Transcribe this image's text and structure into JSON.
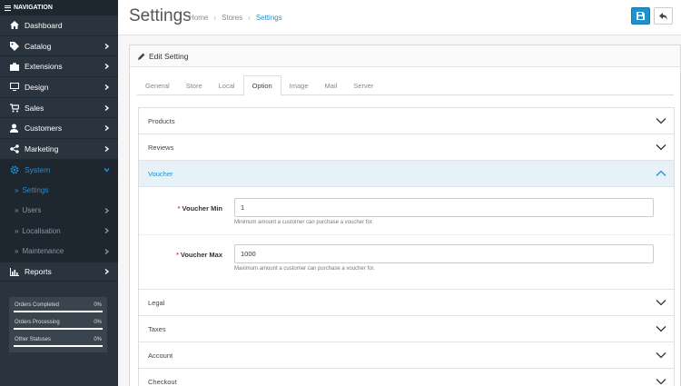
{
  "sidebar": {
    "header": "NAVIGATION",
    "items": [
      {
        "label": "Dashboard",
        "icon": "dashboard-icon",
        "chevron": false
      },
      {
        "label": "Catalog",
        "icon": "tag-icon",
        "chevron": true
      },
      {
        "label": "Extensions",
        "icon": "puzzle-icon",
        "chevron": true
      },
      {
        "label": "Design",
        "icon": "monitor-icon",
        "chevron": true
      },
      {
        "label": "Sales",
        "icon": "cart-icon",
        "chevron": true
      },
      {
        "label": "Customers",
        "icon": "user-icon",
        "chevron": true
      },
      {
        "label": "Marketing",
        "icon": "share-icon",
        "chevron": true
      },
      {
        "label": "System",
        "icon": "gear-icon",
        "chevron": true,
        "active": true
      }
    ],
    "system_submenu": [
      {
        "label": "Settings",
        "active": true,
        "chevron": false
      },
      {
        "label": "Users",
        "chevron": true
      },
      {
        "label": "Localisation",
        "chevron": true
      },
      {
        "label": "Maintenance",
        "chevron": true
      }
    ],
    "reports": {
      "label": "Reports",
      "icon": "bar-chart-icon"
    },
    "stats": [
      {
        "label": "Orders Completed",
        "value": "0%",
        "fraction": 0
      },
      {
        "label": "Orders Processing",
        "value": "0%",
        "fraction": 0
      },
      {
        "label": "Other Statuses",
        "value": "0%",
        "fraction": 0
      }
    ]
  },
  "header": {
    "title": "Settings",
    "breadcrumb": [
      "Home",
      "Stores",
      "Settings"
    ],
    "save_icon": "save-icon",
    "back_icon": "reply-icon"
  },
  "panel": {
    "heading": "Edit Setting",
    "tabs": [
      "General",
      "Store",
      "Local",
      "Option",
      "Image",
      "Mail",
      "Server"
    ],
    "active_tab": "Option",
    "sections_before": [
      "Products",
      "Reviews"
    ],
    "open_section": "Voucher",
    "voucher": {
      "min_label": "Voucher Min",
      "min_value": "1",
      "min_help": "Minimum amount a customer can purchase a voucher for.",
      "max_label": "Voucher Max",
      "max_value": "1000",
      "max_help": "Maximum amount a customer can purchase a voucher for."
    },
    "sections_after": [
      "Legal",
      "Taxes",
      "Account",
      "Checkout"
    ]
  },
  "colors": {
    "sidebar_bg": "#2a343f",
    "accent": "#1e91cf",
    "required": "#e3503e",
    "open_section_bg": "#e6f1f8"
  }
}
